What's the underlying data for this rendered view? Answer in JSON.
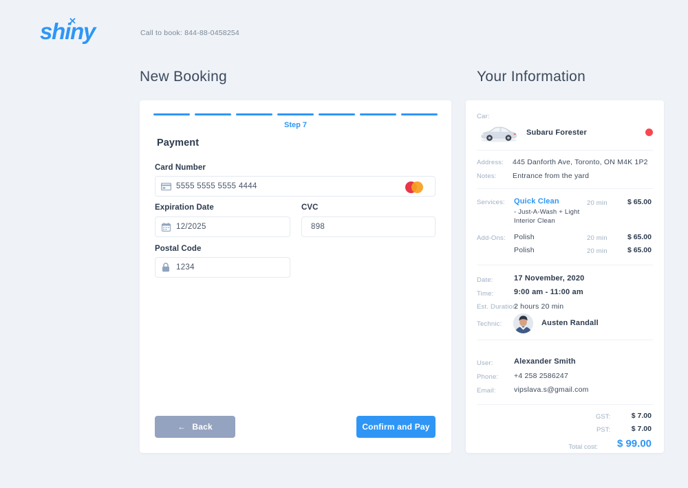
{
  "header": {
    "logo_text": "shiny",
    "logo_spark": "sparkle-icon",
    "call_to_book": "Call to book: 844-88-0458254"
  },
  "sections": {
    "booking_title": "New  Booking",
    "info_title": "Your Information"
  },
  "form": {
    "step_label": "Step 7",
    "steps_total": 7,
    "steps_complete": 7,
    "title": "Payment",
    "fields": {
      "card_number": {
        "label": "Card Number",
        "value": "5555 5555 5555 4444",
        "icon": "credit-card-icon",
        "brand": "mastercard"
      },
      "expiration": {
        "label": "Expiration Date",
        "value": "12/2025",
        "icon": "calendar-icon"
      },
      "cvc": {
        "label": "CVC",
        "value": "898"
      },
      "postal": {
        "label": "Postal Code",
        "value": "1234",
        "icon": "lock-icon"
      }
    },
    "buttons": {
      "back": "Back",
      "back_icon": "arrow-left-icon",
      "confirm": "Confirm and Pay"
    }
  },
  "summary": {
    "car": {
      "key": "Car:",
      "name": "Subaru Forester",
      "color": "#f8474f"
    },
    "address": {
      "key": "Address:",
      "value": "445 Danforth Ave, Toronto, ON M4K 1P2"
    },
    "notes": {
      "key": "Notes:",
      "value": "Entrance from the yard"
    },
    "services": {
      "key": "Services:",
      "name": "Quick Clean",
      "description_line1": "- Just-A-Wash + Light",
      "description_line2": "Interior Clean",
      "duration": "20 min",
      "price": "$ 65.00"
    },
    "addons": {
      "key": "Add-Ons:",
      "items": [
        {
          "name": "Polish",
          "duration": "20 min",
          "price": "$ 65.00"
        },
        {
          "name": "Polish",
          "duration": "20 min",
          "price": "$ 65.00"
        }
      ]
    },
    "date": {
      "key": "Date:",
      "value": "17 November, 2020"
    },
    "time": {
      "key": "Time:",
      "value": "9:00 am - 11:00 am"
    },
    "duration": {
      "key": "Est. Duration:",
      "value": "2 hours 20 min"
    },
    "technician": {
      "key": "Technic:",
      "name": "Austen Randall"
    },
    "user": {
      "key": "User:",
      "value": "Alexander Smith"
    },
    "phone": {
      "key": "Phone:",
      "value": "+4 258 2586247"
    },
    "email": {
      "key": "Email:",
      "value": "vipslava.s@gmail.com"
    },
    "totals": {
      "gst_key": "GST:",
      "gst_value": "$ 7.00",
      "pst_key": "PST:",
      "pst_value": "$ 7.00",
      "total_key": "Total cost:",
      "total_value": "$ 99.00"
    }
  },
  "colors": {
    "accent": "#2f96f6",
    "background": "#eff3f8",
    "muted": "#94a3bf",
    "danger": "#f8474f"
  }
}
